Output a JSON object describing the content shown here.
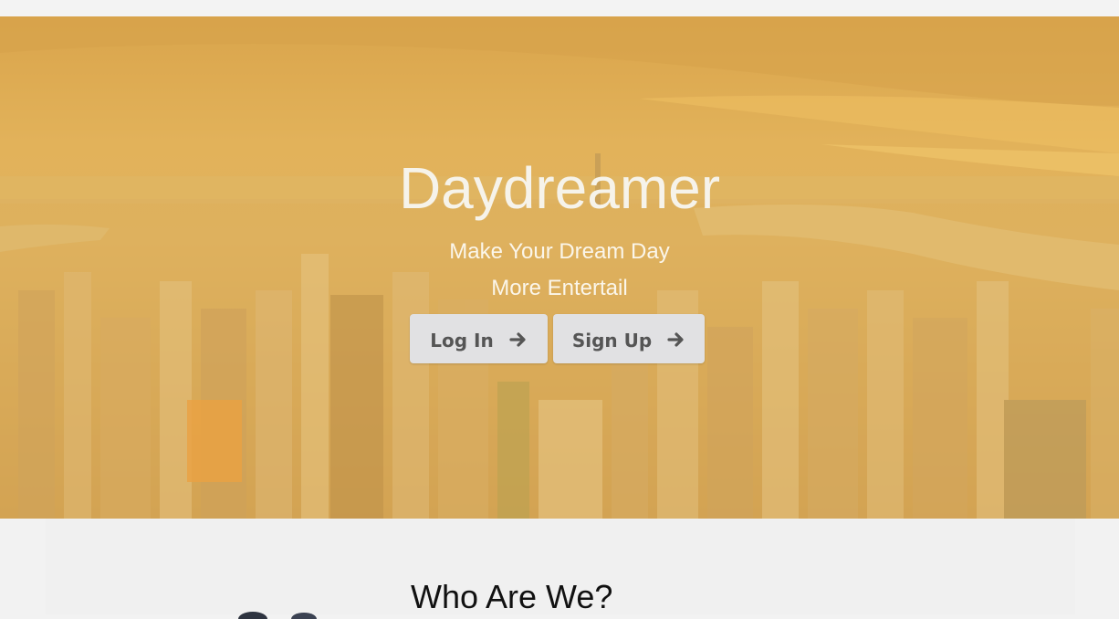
{
  "hero": {
    "title": "Daydreamer",
    "subtitle_line1": "Make Your Dream Day",
    "subtitle_line2": "More Entertail",
    "buttons": {
      "login_label": "Log In",
      "signup_label": "Sign Up"
    }
  },
  "about": {
    "title": "Who Are We?"
  },
  "colors": {
    "overlay": "#eebe5c",
    "button_bg": "#e1e1e3",
    "button_text": "#555555"
  },
  "icons": {
    "login_arrow": "arrow-right-icon",
    "signup_arrow": "arrow-right-icon"
  }
}
